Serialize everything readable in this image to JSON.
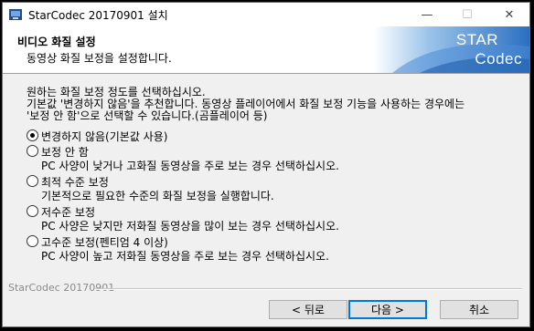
{
  "window": {
    "title": "StarCodec 20170901 설치",
    "controls": {
      "minimize": "—",
      "maximize": "☐",
      "close": "✕"
    }
  },
  "header": {
    "title": "비디오 화질 설정",
    "subtitle": "동영상 화질 보정을 설정합니다.",
    "logo_line1": "STAR",
    "logo_line2": "Codec"
  },
  "intro": {
    "line1": "원하는 화질 보정 정도를 선택하십시오.",
    "line2": "기본값 '변경하지 않음'을 추천합니다. 동영상 플레이어에서 화질 보정 기능을 사용하는 경우에는",
    "line3": "'보정 안 함'으로 선택할 수 있습니다.(곰플레이어 등)"
  },
  "options": [
    {
      "label": "변경하지 않음(기본값 사용)",
      "description": "",
      "checked": true
    },
    {
      "label": "보정 안 함",
      "description": "PC 사양이 낮거나 고화질 동영상을 주로 보는 경우 선택하십시오.",
      "checked": false
    },
    {
      "label": "최적 수준 보정",
      "description": "기본적으로 필요한 수준의 화질 보정을 실행합니다.",
      "checked": false
    },
    {
      "label": "저수준 보정",
      "description": "PC 사양은 낮지만 저화질 동영상을 많이 보는 경우 선택하십시오.",
      "checked": false
    },
    {
      "label": "고수준 보정(펜티엄 4 이상)",
      "description": "PC 사양이 높고 저화질 동영상을 주로 보는 경우 선택하십시오.",
      "checked": false
    }
  ],
  "footer": {
    "brand": "StarCodec 20170901",
    "back_label": "< 뒤로",
    "next_label": "다음 >",
    "cancel_label": "취소"
  }
}
